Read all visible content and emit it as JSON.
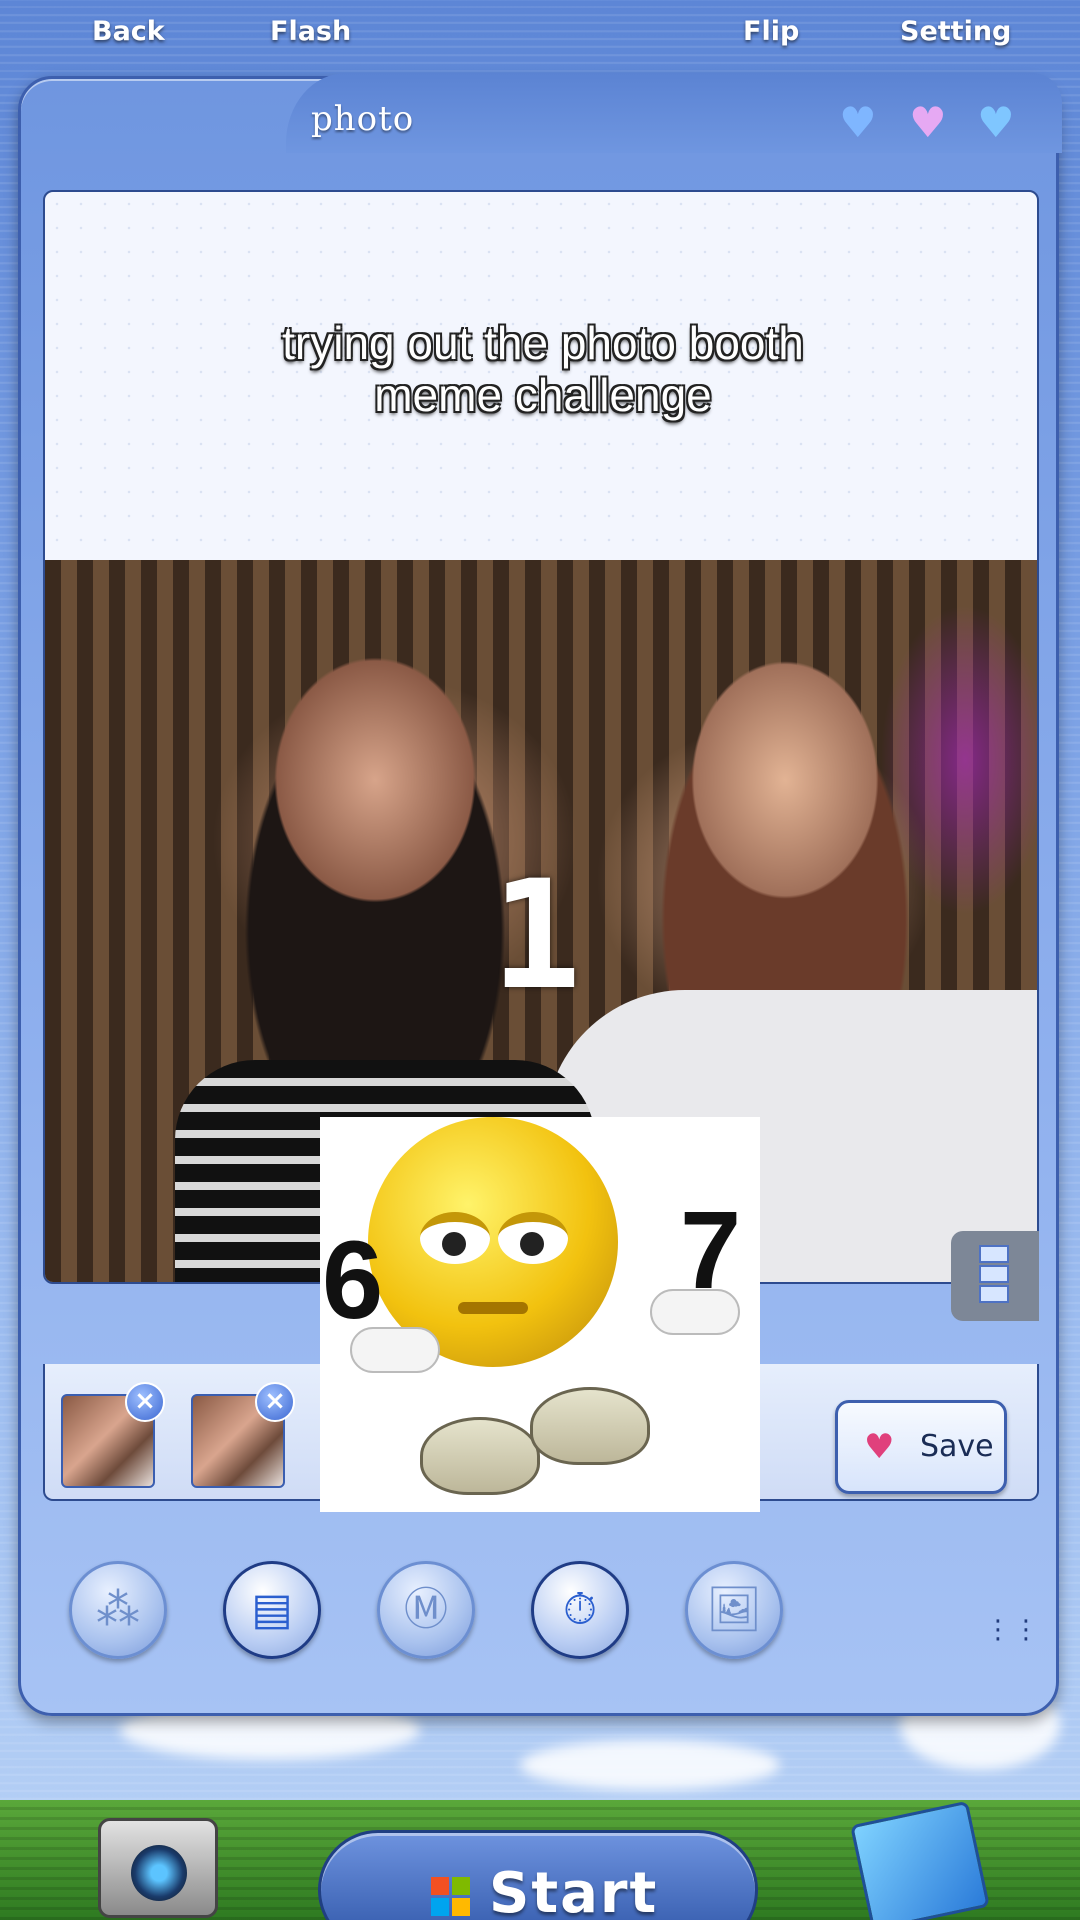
{
  "topbar": {
    "back_label": "Back",
    "flash_label": "Flash",
    "flip_label": "Flip",
    "setting_label": "Setting"
  },
  "window": {
    "title": "photo",
    "hearts": [
      "heart-blue-icon",
      "heart-pink-icon",
      "heart-blue-icon"
    ]
  },
  "preview": {
    "caption_line1": "trying out the photo booth",
    "caption_line2": "meme challenge",
    "countdown": "1",
    "meme_left_number": "6",
    "meme_right_number": "7"
  },
  "strip": {
    "thumbnail_count": 2,
    "close_glyph": "×",
    "save_label": "Save"
  },
  "toolbar": {
    "tools": [
      {
        "name": "filters-icon",
        "glyph": "⁂"
      },
      {
        "name": "layout-strip-icon",
        "glyph": "▤"
      },
      {
        "name": "multi-photo-icon",
        "glyph": "Ⓜ"
      },
      {
        "name": "timer-3s-icon",
        "glyph": "⏱"
      },
      {
        "name": "add-image-icon",
        "glyph": "🖼"
      }
    ],
    "more_glyph": "⋮⋮"
  },
  "taskbar": {
    "start_label": "Start"
  },
  "colors": {
    "accent": "#3d5fae",
    "start": "#2f56a8",
    "save_heart": "#e0407c"
  }
}
